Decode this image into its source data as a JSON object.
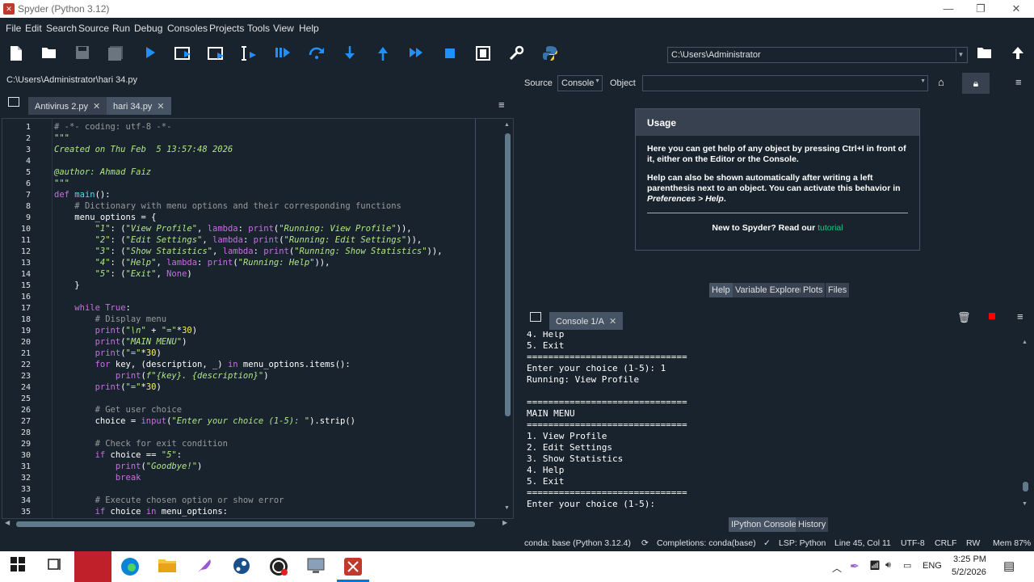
{
  "window": {
    "title": "Spyder (Python 3.12)"
  },
  "menu": [
    "File",
    "Edit",
    "Search",
    "Source",
    "Run",
    "Debug",
    "Consoles",
    "Projects",
    "Tools",
    "View",
    "Help"
  ],
  "toolbar": {
    "path": "C:\\Users\\Administrator"
  },
  "editor": {
    "filepath": "C:\\Users\\Administrator\\hari 34.py",
    "tabs": [
      {
        "label": "Antivirus 2.py"
      },
      {
        "label": "hari 34.py"
      }
    ],
    "active_tab": 1,
    "line_numbers": [
      "1",
      "2",
      "3",
      "4",
      "5",
      "6",
      "7",
      "8",
      "9",
      "10",
      "11",
      "12",
      "13",
      "14",
      "15",
      "16",
      "17",
      "18",
      "19",
      "20",
      "21",
      "22",
      "23",
      "24",
      "25",
      "26",
      "27",
      "28",
      "29",
      "30",
      "31",
      "32",
      "33",
      "34",
      "35"
    ]
  },
  "help": {
    "source_label": "Source",
    "source_value": "Console",
    "object_label": "Object",
    "usage_title": "Usage",
    "p1": "Here you can get help of any object by pressing Ctrl+I in front of it, either on the Editor or the Console.",
    "p2a": "Help can also be shown automatically after writing a left parenthesis next to an object. You can activate this behavior in ",
    "p2b": "Preferences > Help",
    "p2c": ".",
    "new_text": "New to Spyder? Read our ",
    "new_link": "tutorial",
    "tabs": [
      "Help",
      "Variable Explorer",
      "Plots",
      "Files"
    ]
  },
  "console": {
    "tab": "Console 1/A",
    "lines": [
      "4. Help",
      "5. Exit",
      "==============================",
      "Enter your choice (1-5): 1",
      "Running: View Profile",
      "",
      "==============================",
      "MAIN MENU",
      "==============================",
      "1. View Profile",
      "2. Edit Settings",
      "3. Show Statistics",
      "4. Help",
      "5. Exit",
      "==============================",
      "Enter your choice (1-5):"
    ],
    "bottom_tabs": [
      "IPython Console",
      "History"
    ]
  },
  "status": {
    "env": "conda: base (Python 3.12.4)",
    "completions": "Completions: conda(base)",
    "lsp": "LSP: Python",
    "position": "Line 45, Col 11",
    "encoding": "UTF-8",
    "eol": "CRLF",
    "rw": "RW",
    "mem": "Mem 87%"
  },
  "taskbar": {
    "lang": "ENG",
    "time": "3:25 PM",
    "date": "5/2/2026"
  },
  "colors": {
    "background": "#19232d",
    "accent": "#26c281",
    "keyword": "#c670e0",
    "string": "#b0e686"
  }
}
